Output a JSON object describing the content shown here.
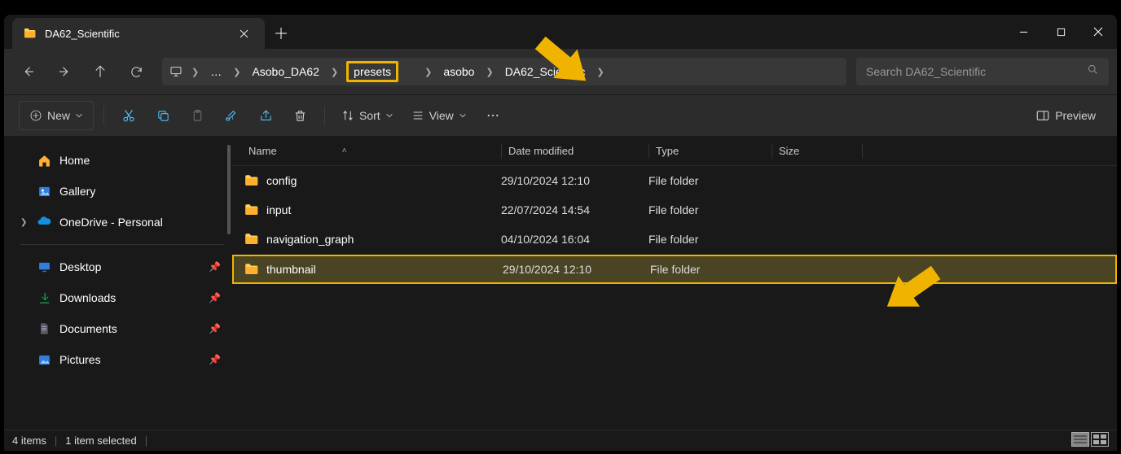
{
  "tab": {
    "title": "DA62_Scientific"
  },
  "breadcrumb": {
    "segments": [
      "Asobo_DA62",
      "presets",
      "asobo",
      "DA62_Scientific"
    ],
    "highlighted_index": 1
  },
  "search": {
    "placeholder": "Search DA62_Scientific"
  },
  "toolbar": {
    "new_label": "New",
    "sort_label": "Sort",
    "view_label": "View",
    "preview_label": "Preview"
  },
  "sidebar": {
    "top": [
      {
        "label": "Home",
        "icon": "home-icon"
      },
      {
        "label": "Gallery",
        "icon": "gallery-icon"
      },
      {
        "label": "OneDrive - Personal",
        "icon": "onedrive-icon",
        "expandable": true
      }
    ],
    "quick": [
      {
        "label": "Desktop",
        "icon": "desktop-icon"
      },
      {
        "label": "Downloads",
        "icon": "downloads-icon"
      },
      {
        "label": "Documents",
        "icon": "documents-icon"
      },
      {
        "label": "Pictures",
        "icon": "pictures-icon"
      }
    ]
  },
  "columns": {
    "name": "Name",
    "date": "Date modified",
    "type": "Type",
    "size": "Size"
  },
  "rows": [
    {
      "name": "config",
      "date": "29/10/2024 12:10",
      "type": "File folder",
      "size": ""
    },
    {
      "name": "input",
      "date": "22/07/2024 14:54",
      "type": "File folder",
      "size": ""
    },
    {
      "name": "navigation_graph",
      "date": "04/10/2024 16:04",
      "type": "File folder",
      "size": ""
    },
    {
      "name": "thumbnail",
      "date": "29/10/2024 12:10",
      "type": "File folder",
      "size": "",
      "selected": true
    }
  ],
  "status": {
    "count": "4 items",
    "selected": "1 item selected"
  }
}
